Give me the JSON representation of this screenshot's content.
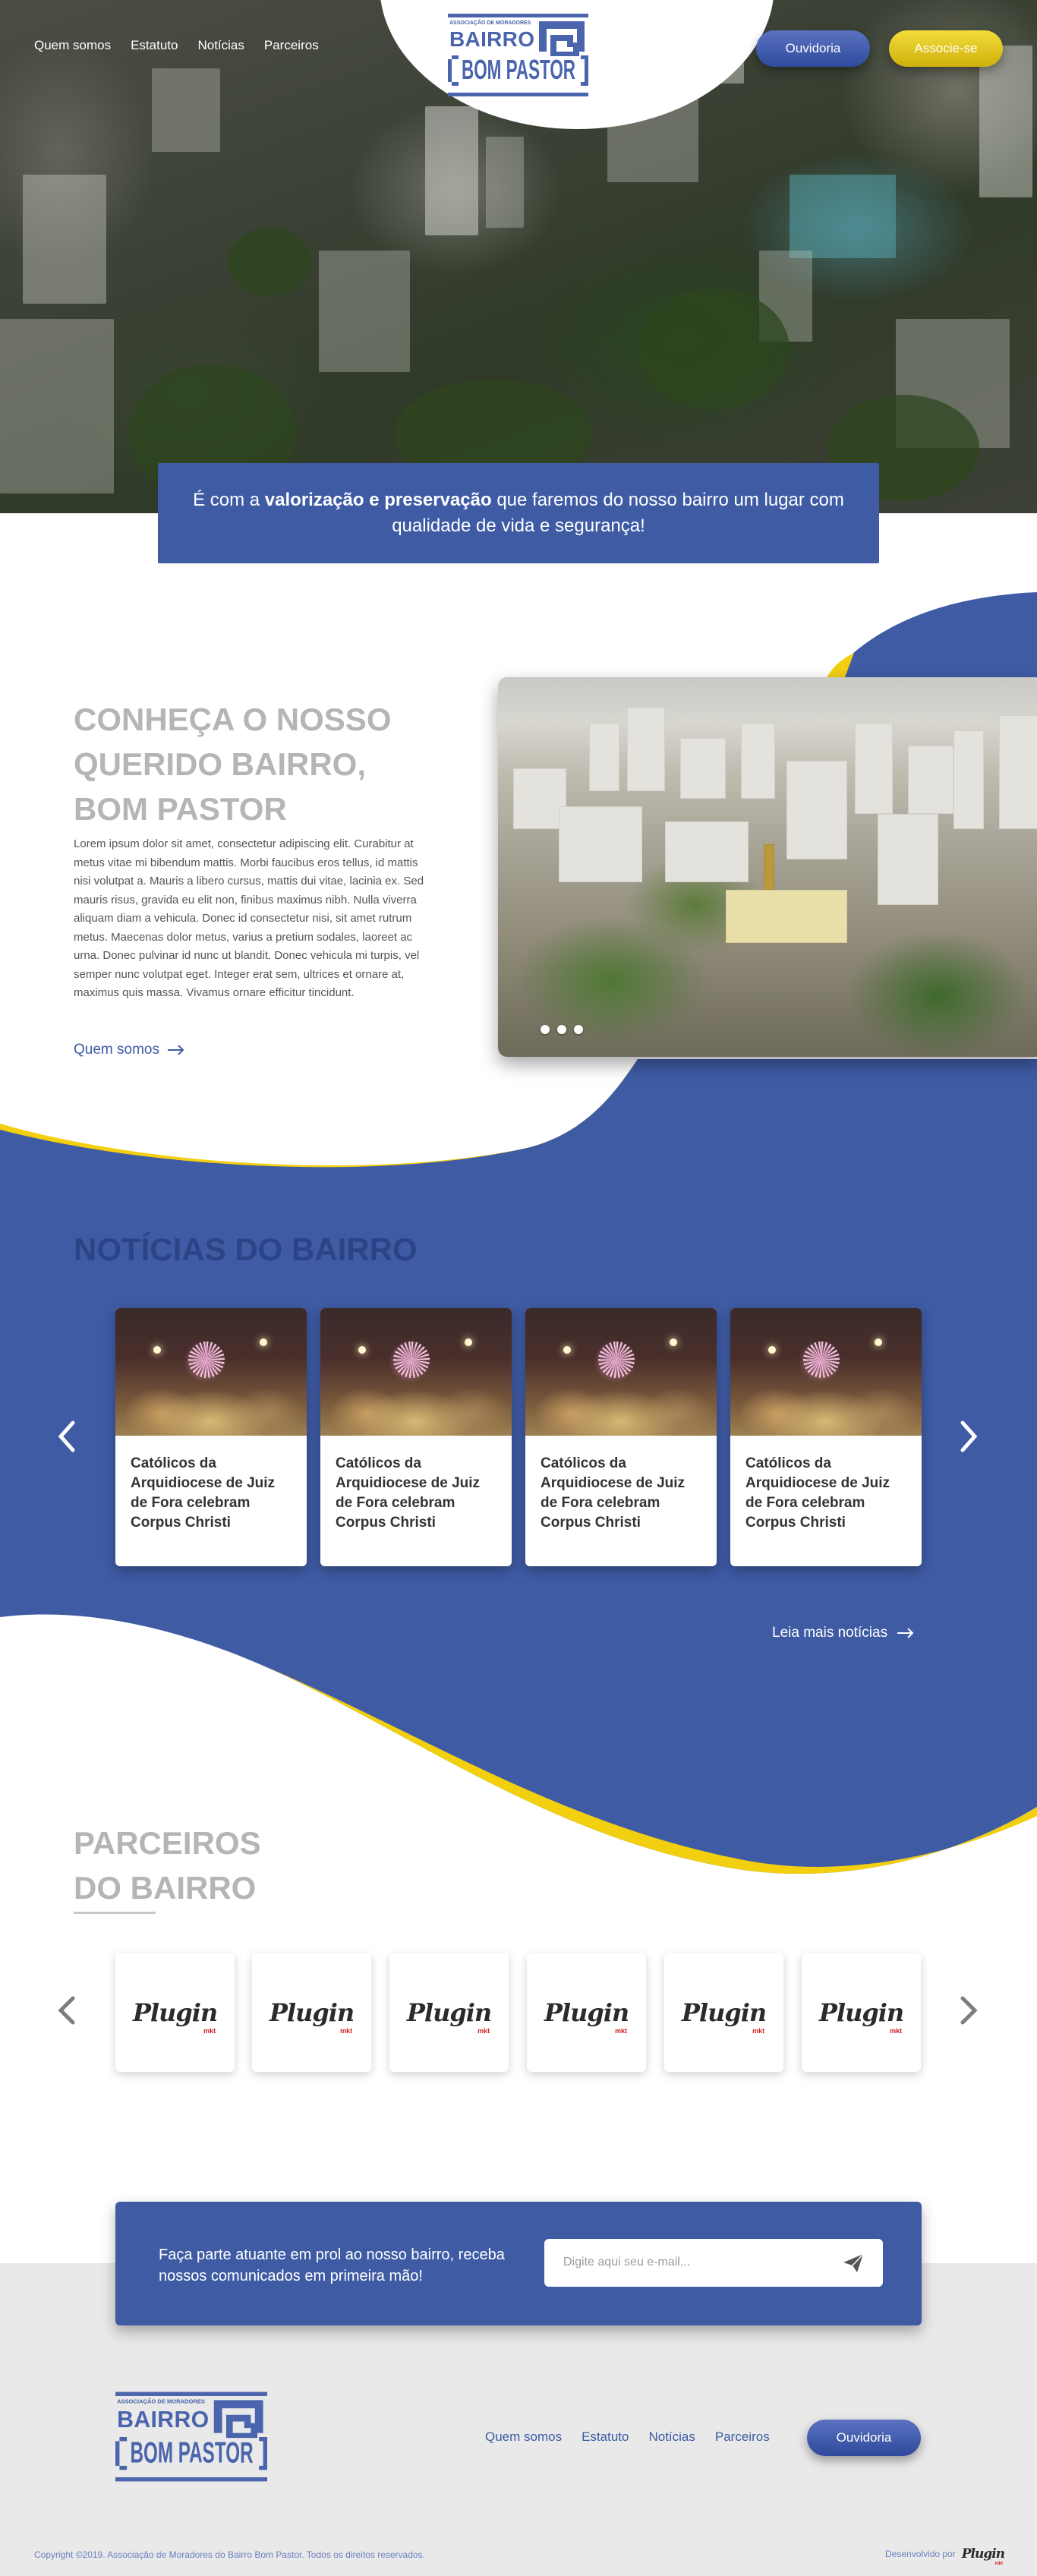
{
  "nav": {
    "items": [
      {
        "label": "Quem somos"
      },
      {
        "label": "Estatuto"
      },
      {
        "label": "Notícias"
      },
      {
        "label": "Parceiros"
      }
    ],
    "ouvidoria_label": "Ouvidoria",
    "associe_label": "Associe-se"
  },
  "logo": {
    "line_small": "ASSOCIAÇÃO DE MORADORES",
    "line1": "BAIRRO",
    "line2": "BOM PASTOR"
  },
  "hero": {
    "quote_pre": "É com a ",
    "quote_bold": "valorização e preservação",
    "quote_post": " que faremos do nosso bairro um lugar com qualidade de vida e segurança!"
  },
  "about": {
    "title_line1": "CONHEÇA O NOSSO",
    "title_line2": "QUERIDO BAIRRO,",
    "title_line3": "BOM PASTOR",
    "text": "Lorem ipsum dolor sit amet, consectetur adipiscing elit. Curabitur at metus vitae mi bibendum mattis. Morbi faucibus eros tellus, id mattis nisi volutpat a. Mauris a libero cursus, mattis dui vitae, lacinia ex. Sed mauris risus, gravida eu elit non, finibus maximus nibh. Nulla viverra aliquam diam a vehicula. Donec id consectetur nisi, sit amet rutrum metus. Maecenas dolor metus, varius a pretium sodales, laoreet ac urna. Donec pulvinar id nunc ut blandit. Donec vehicula mi turpis, vel semper nunc volutpat eget. Integer erat sem, ultrices et ornare at, maximus quis massa. Vivamus ornare efficitur tincidunt.",
    "link_label": "Quem somos",
    "slide_count": 3
  },
  "news": {
    "title": "NOTÍCIAS DO BAIRRO",
    "cards": [
      {
        "title": "Católicos da Arquidiocese de Juiz de Fora celebram Corpus Christi"
      },
      {
        "title": "Católicos da Arquidiocese de Juiz de Fora celebram Corpus Christi"
      },
      {
        "title": "Católicos da Arquidiocese de Juiz de Fora celebram Corpus Christi"
      },
      {
        "title": "Católicos da Arquidiocese de Juiz de Fora celebram Corpus Christi"
      }
    ],
    "more_label": "Leia mais notícias"
  },
  "partners": {
    "title_line1": "PARCEIROS",
    "title_line2": "DO BAIRRO",
    "logos": [
      {
        "name": "Plugin",
        "sub": "mkt"
      },
      {
        "name": "Plugin",
        "sub": "mkt"
      },
      {
        "name": "Plugin",
        "sub": "mkt"
      },
      {
        "name": "Plugin",
        "sub": "mkt"
      },
      {
        "name": "Plugin",
        "sub": "mkt"
      },
      {
        "name": "Plugin",
        "sub": "mkt"
      }
    ]
  },
  "newsletter": {
    "text": "Faça parte atuante em prol ao nosso bairro, receba nossos comunicados em primeira mão!",
    "placeholder": "Digite aqui seu e-mail..."
  },
  "footer": {
    "nav": [
      {
        "label": "Quem somos"
      },
      {
        "label": "Estatuto"
      },
      {
        "label": "Notícias"
      },
      {
        "label": "Parceiros"
      }
    ],
    "ouvidoria_label": "Ouvidoria",
    "copyright": "Copyright ©2019. Associação de Moradores do Bairro Bom Pastor. Todos os direitos reservados.",
    "dev_label": "Desenvolvido por",
    "dev_logo": {
      "name": "Plugin",
      "sub": "mkt"
    }
  },
  "colors": {
    "brand_blue": "#3e5ba4",
    "dark_blue": "#2c4386",
    "accent_yellow": "#f2cf0f",
    "title_grey": "#b5b5b5"
  },
  "icons": {
    "arrow_right": "arrow-right-icon",
    "chevron_left": "chevron-left-icon",
    "chevron_right": "chevron-right-icon",
    "send": "paper-plane-icon"
  }
}
